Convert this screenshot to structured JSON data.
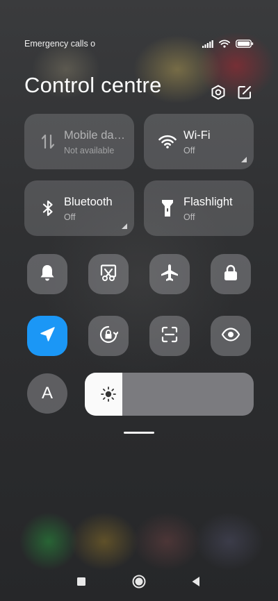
{
  "status_bar": {
    "carrier_text": "Emergency calls o"
  },
  "header": {
    "title": "Control centre"
  },
  "tiles": [
    {
      "name": "Mobile da…",
      "status": "Not available"
    },
    {
      "name": "Wi-Fi",
      "status": "Off"
    },
    {
      "name": "Bluetooth",
      "status": "Off"
    },
    {
      "name": "Flashlight",
      "status": "Off"
    }
  ],
  "toggles": {
    "font_letter": "A"
  },
  "colors": {
    "accent": "#1b97f6"
  },
  "icons": [
    "signal-icon",
    "wifi-status-icon",
    "battery-icon",
    "settings-icon",
    "edit-icon",
    "mobile-data-icon",
    "wifi-icon",
    "bluetooth-icon",
    "flashlight-icon",
    "bell-icon",
    "screenshot-icon",
    "airplane-icon",
    "lock-icon",
    "location-icon",
    "rotation-lock-icon",
    "scanner-icon",
    "eye-icon",
    "font-icon",
    "brightness-icon",
    "recents-icon",
    "home-icon",
    "back-icon"
  ]
}
